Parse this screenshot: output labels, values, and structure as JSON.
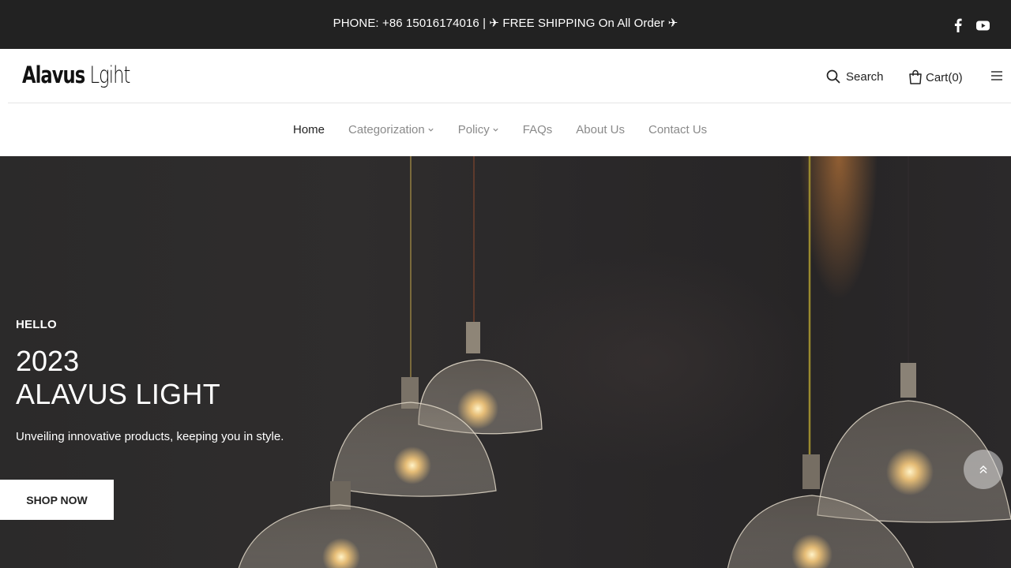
{
  "topbar": {
    "announcement": "PHONE: +86 15016174016 | ✈ FREE SHIPPING On All Order ✈",
    "social": [
      {
        "icon": "facebook-icon"
      },
      {
        "icon": "youtube-icon"
      }
    ]
  },
  "header": {
    "logo_bold": "Alavus",
    "logo_light": "Lgiht",
    "search_label": "Search",
    "cart_label": "Cart(0)",
    "menu_icon": "hamburger-icon"
  },
  "nav": {
    "items": [
      {
        "label": "Home",
        "active": true,
        "dropdown": false
      },
      {
        "label": "Categorization",
        "active": false,
        "dropdown": true
      },
      {
        "label": "Policy",
        "active": false,
        "dropdown": true
      },
      {
        "label": "FAQs",
        "active": false,
        "dropdown": false
      },
      {
        "label": "About Us",
        "active": false,
        "dropdown": false
      },
      {
        "label": "Contact Us",
        "active": false,
        "dropdown": false
      }
    ]
  },
  "hero": {
    "kicker": "HELLO",
    "year": "2023",
    "title": "ALAVUS LIGHT",
    "subtitle": "Unveiling innovative products, keeping you in style.",
    "cta": "SHOP NOW"
  },
  "colors": {
    "topbar_bg": "#222222",
    "nav_active": "#222222",
    "nav_inactive": "#8a8a8a",
    "hero_bg": "#2c2a2b"
  },
  "scroll_top_icon": "double-chevron-up-icon"
}
